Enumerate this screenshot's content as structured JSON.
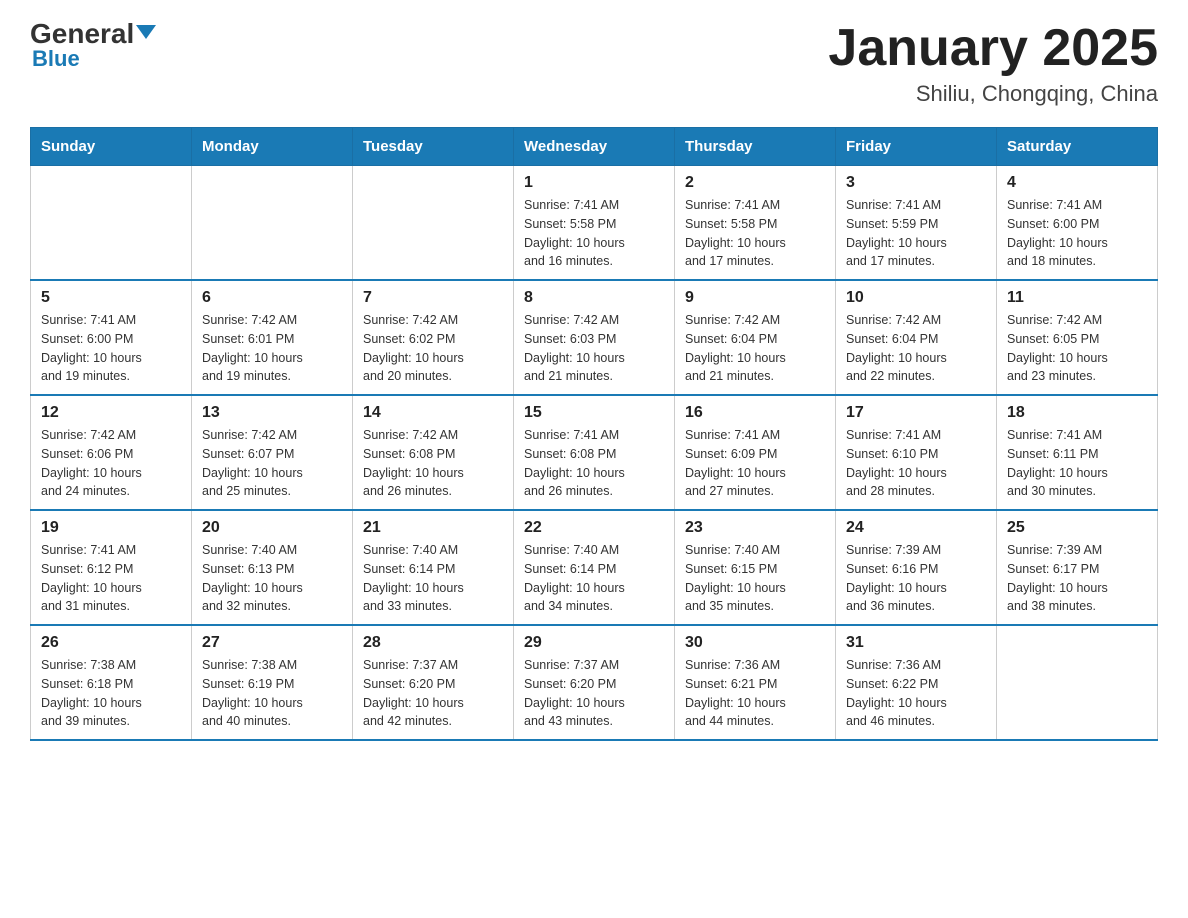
{
  "logo": {
    "general": "General",
    "blue": "Blue"
  },
  "title": "January 2025",
  "subtitle": "Shiliu, Chongqing, China",
  "days": [
    "Sunday",
    "Monday",
    "Tuesday",
    "Wednesday",
    "Thursday",
    "Friday",
    "Saturday"
  ],
  "weeks": [
    [
      {
        "day": "",
        "info": ""
      },
      {
        "day": "",
        "info": ""
      },
      {
        "day": "",
        "info": ""
      },
      {
        "day": "1",
        "info": "Sunrise: 7:41 AM\nSunset: 5:58 PM\nDaylight: 10 hours\nand 16 minutes."
      },
      {
        "day": "2",
        "info": "Sunrise: 7:41 AM\nSunset: 5:58 PM\nDaylight: 10 hours\nand 17 minutes."
      },
      {
        "day": "3",
        "info": "Sunrise: 7:41 AM\nSunset: 5:59 PM\nDaylight: 10 hours\nand 17 minutes."
      },
      {
        "day": "4",
        "info": "Sunrise: 7:41 AM\nSunset: 6:00 PM\nDaylight: 10 hours\nand 18 minutes."
      }
    ],
    [
      {
        "day": "5",
        "info": "Sunrise: 7:41 AM\nSunset: 6:00 PM\nDaylight: 10 hours\nand 19 minutes."
      },
      {
        "day": "6",
        "info": "Sunrise: 7:42 AM\nSunset: 6:01 PM\nDaylight: 10 hours\nand 19 minutes."
      },
      {
        "day": "7",
        "info": "Sunrise: 7:42 AM\nSunset: 6:02 PM\nDaylight: 10 hours\nand 20 minutes."
      },
      {
        "day": "8",
        "info": "Sunrise: 7:42 AM\nSunset: 6:03 PM\nDaylight: 10 hours\nand 21 minutes."
      },
      {
        "day": "9",
        "info": "Sunrise: 7:42 AM\nSunset: 6:04 PM\nDaylight: 10 hours\nand 21 minutes."
      },
      {
        "day": "10",
        "info": "Sunrise: 7:42 AM\nSunset: 6:04 PM\nDaylight: 10 hours\nand 22 minutes."
      },
      {
        "day": "11",
        "info": "Sunrise: 7:42 AM\nSunset: 6:05 PM\nDaylight: 10 hours\nand 23 minutes."
      }
    ],
    [
      {
        "day": "12",
        "info": "Sunrise: 7:42 AM\nSunset: 6:06 PM\nDaylight: 10 hours\nand 24 minutes."
      },
      {
        "day": "13",
        "info": "Sunrise: 7:42 AM\nSunset: 6:07 PM\nDaylight: 10 hours\nand 25 minutes."
      },
      {
        "day": "14",
        "info": "Sunrise: 7:42 AM\nSunset: 6:08 PM\nDaylight: 10 hours\nand 26 minutes."
      },
      {
        "day": "15",
        "info": "Sunrise: 7:41 AM\nSunset: 6:08 PM\nDaylight: 10 hours\nand 26 minutes."
      },
      {
        "day": "16",
        "info": "Sunrise: 7:41 AM\nSunset: 6:09 PM\nDaylight: 10 hours\nand 27 minutes."
      },
      {
        "day": "17",
        "info": "Sunrise: 7:41 AM\nSunset: 6:10 PM\nDaylight: 10 hours\nand 28 minutes."
      },
      {
        "day": "18",
        "info": "Sunrise: 7:41 AM\nSunset: 6:11 PM\nDaylight: 10 hours\nand 30 minutes."
      }
    ],
    [
      {
        "day": "19",
        "info": "Sunrise: 7:41 AM\nSunset: 6:12 PM\nDaylight: 10 hours\nand 31 minutes."
      },
      {
        "day": "20",
        "info": "Sunrise: 7:40 AM\nSunset: 6:13 PM\nDaylight: 10 hours\nand 32 minutes."
      },
      {
        "day": "21",
        "info": "Sunrise: 7:40 AM\nSunset: 6:14 PM\nDaylight: 10 hours\nand 33 minutes."
      },
      {
        "day": "22",
        "info": "Sunrise: 7:40 AM\nSunset: 6:14 PM\nDaylight: 10 hours\nand 34 minutes."
      },
      {
        "day": "23",
        "info": "Sunrise: 7:40 AM\nSunset: 6:15 PM\nDaylight: 10 hours\nand 35 minutes."
      },
      {
        "day": "24",
        "info": "Sunrise: 7:39 AM\nSunset: 6:16 PM\nDaylight: 10 hours\nand 36 minutes."
      },
      {
        "day": "25",
        "info": "Sunrise: 7:39 AM\nSunset: 6:17 PM\nDaylight: 10 hours\nand 38 minutes."
      }
    ],
    [
      {
        "day": "26",
        "info": "Sunrise: 7:38 AM\nSunset: 6:18 PM\nDaylight: 10 hours\nand 39 minutes."
      },
      {
        "day": "27",
        "info": "Sunrise: 7:38 AM\nSunset: 6:19 PM\nDaylight: 10 hours\nand 40 minutes."
      },
      {
        "day": "28",
        "info": "Sunrise: 7:37 AM\nSunset: 6:20 PM\nDaylight: 10 hours\nand 42 minutes."
      },
      {
        "day": "29",
        "info": "Sunrise: 7:37 AM\nSunset: 6:20 PM\nDaylight: 10 hours\nand 43 minutes."
      },
      {
        "day": "30",
        "info": "Sunrise: 7:36 AM\nSunset: 6:21 PM\nDaylight: 10 hours\nand 44 minutes."
      },
      {
        "day": "31",
        "info": "Sunrise: 7:36 AM\nSunset: 6:22 PM\nDaylight: 10 hours\nand 46 minutes."
      },
      {
        "day": "",
        "info": ""
      }
    ]
  ]
}
